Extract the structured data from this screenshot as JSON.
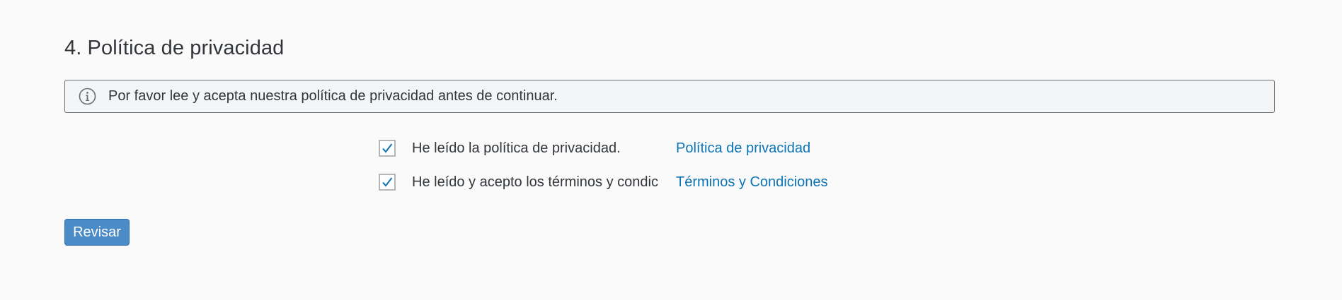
{
  "section": {
    "title": "4. Política de privacidad"
  },
  "info": {
    "icon": "info-icon",
    "message": "Por favor lee y acepta nuestra política de privacidad antes de continuar."
  },
  "consents": [
    {
      "label": "He leído la política de privacidad.",
      "link": "Política de privacidad",
      "checked": true
    },
    {
      "label": "He leído y acepto los términos y condic",
      "link": "Términos y Condiciones",
      "checked": true
    }
  ],
  "actions": {
    "review_label": "Revisar"
  },
  "colors": {
    "link": "#0b74b6",
    "button": "#4a8bc8",
    "checkmark": "#0b74b6"
  }
}
